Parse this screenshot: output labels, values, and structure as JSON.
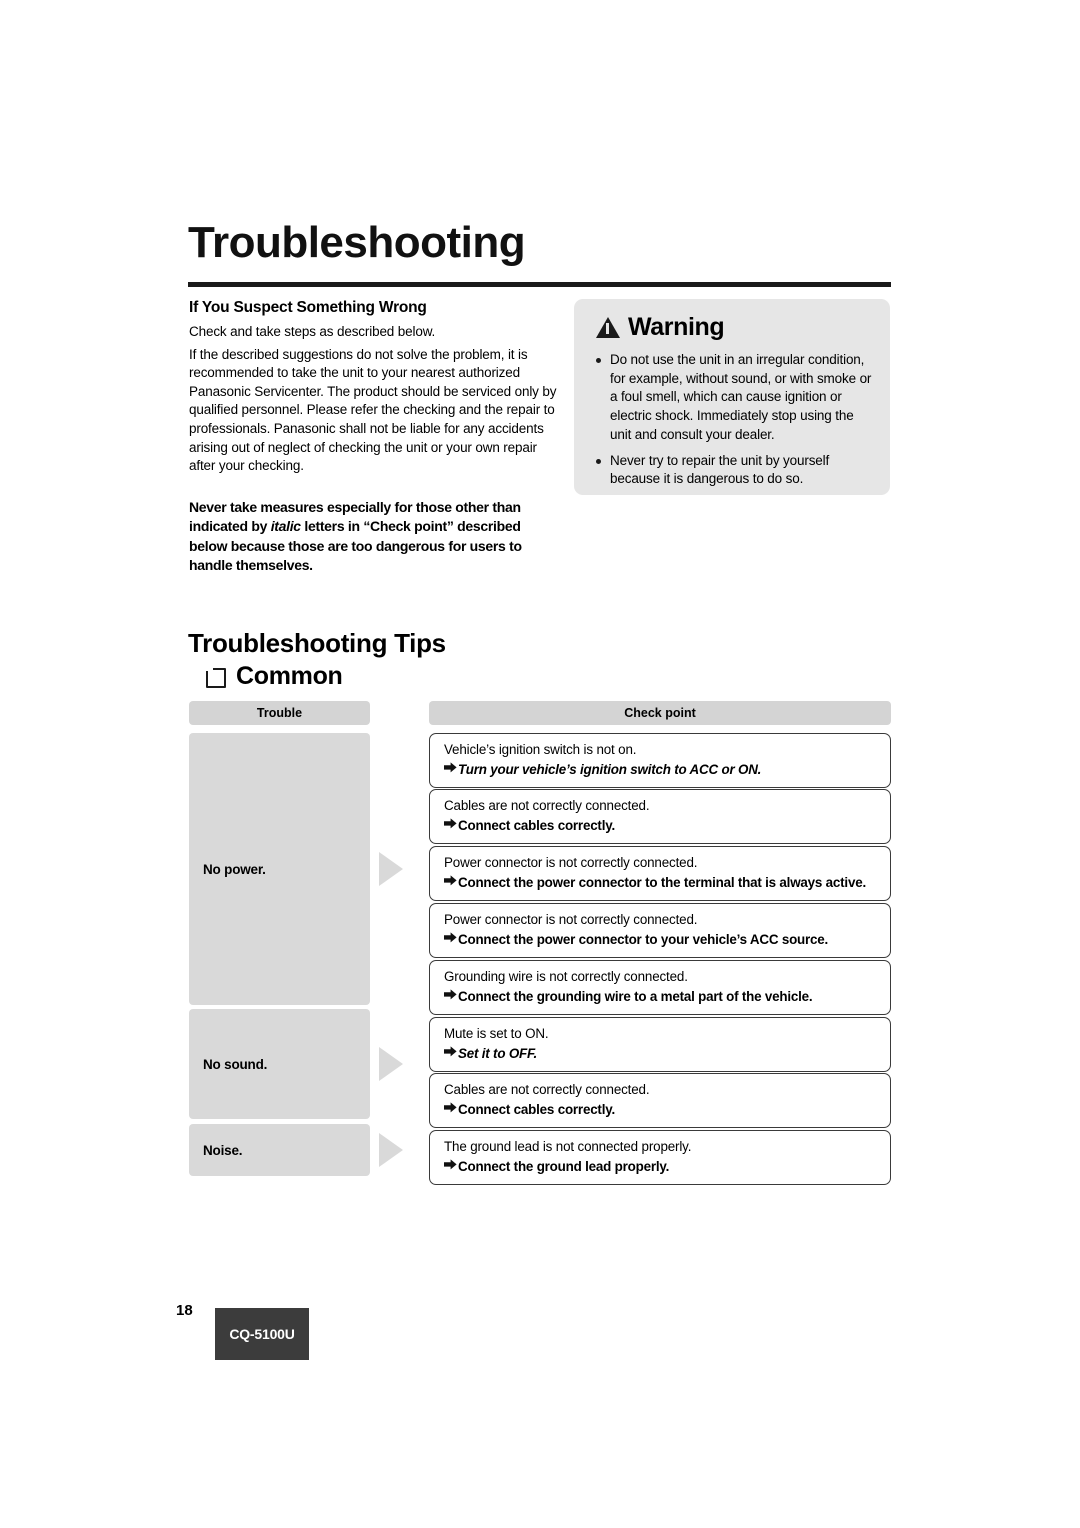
{
  "page": {
    "title": "Troubleshooting",
    "page_number": "18",
    "model": "CQ-5100U"
  },
  "intro": {
    "heading": "If You Suspect Something Wrong",
    "para1": "Check and take steps as described below.",
    "para2": "If the described suggestions do not solve the problem, it is recommended to take the unit to your nearest authorized Panasonic Servicenter. The product should be serviced only by qualified personnel. Please refer the checking and the repair to professionals. Panasonic shall not be liable for any accidents arising out of neglect of checking the unit or your own repair after your checking.",
    "bold_note_pre": "Never take measures especially for those other than indicated by ",
    "bold_note_italic": "italic",
    "bold_note_post": " letters in “Check point” described below because those are too dangerous for users to handle themselves."
  },
  "warning": {
    "title": "Warning",
    "icon": "warning-triangle-icon",
    "items": [
      "Do not use the unit in an irregular condition, for example, without sound, or with smoke or a foul smell, which can cause ignition or electric shock. Immediately stop using the unit and consult your dealer.",
      "Never try to repair the unit by yourself because it is dangerous to do so."
    ]
  },
  "tips": {
    "title": "Troubleshooting Tips",
    "section": "Common",
    "headers": {
      "trouble": "Trouble",
      "check_point": "Check point"
    },
    "groups": [
      {
        "trouble": "No power.",
        "rows": [
          {
            "cause": "Vehicle’s ignition switch is not on.",
            "solution": "Turn your vehicle’s ignition switch to ACC or ON.",
            "italic": true
          },
          {
            "cause": "Cables are not correctly connected.",
            "solution": "Connect cables correctly.",
            "italic": false
          },
          {
            "cause": "Power connector is not correctly connected.",
            "solution": "Connect the power connector to the terminal that is always active.",
            "italic": false
          },
          {
            "cause": "Power connector is not correctly connected.",
            "solution": "Connect the power connector to your vehicle’s ACC source.",
            "italic": false
          },
          {
            "cause": "Grounding wire is not correctly connected.",
            "solution": "Connect the grounding wire to a metal part of the vehicle.",
            "italic": false
          }
        ]
      },
      {
        "trouble": "No sound.",
        "rows": [
          {
            "cause": "Mute is set to ON.",
            "solution": "Set it to OFF.",
            "italic": true
          },
          {
            "cause": "Cables are not correctly connected.",
            "solution": "Connect cables correctly.",
            "italic": false
          }
        ]
      },
      {
        "trouble": "Noise.",
        "rows": [
          {
            "cause": "The ground lead is not connected properly.",
            "solution": "Connect the ground lead properly.",
            "italic": false
          }
        ]
      }
    ]
  }
}
